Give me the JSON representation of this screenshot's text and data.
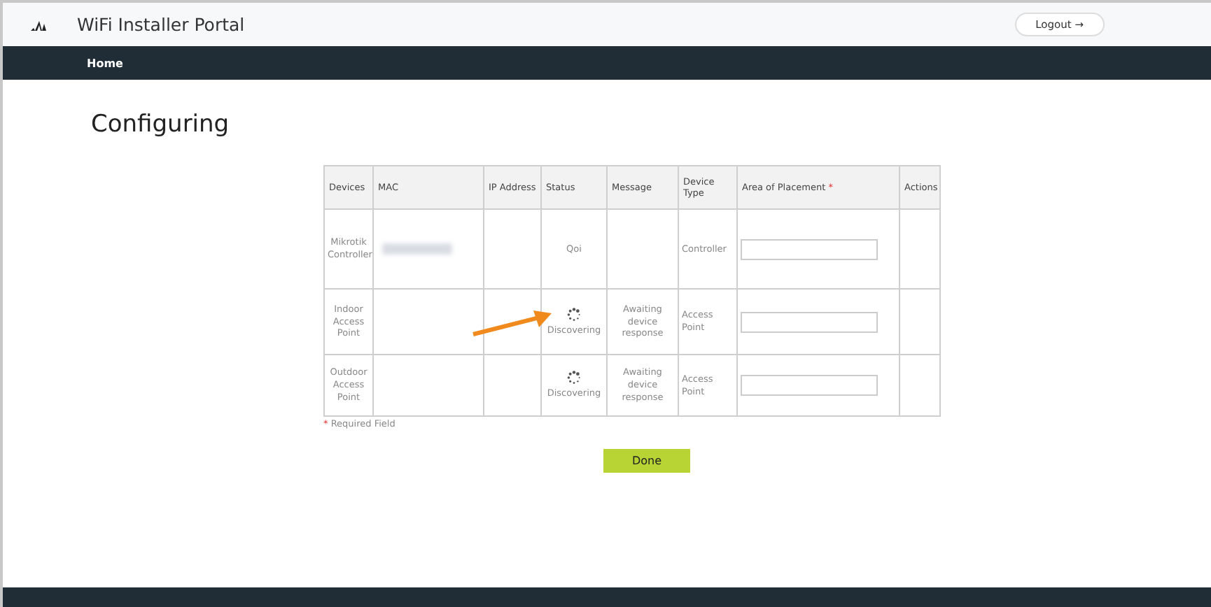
{
  "header": {
    "title": "WiFi Installer Portal",
    "logout": "Logout",
    "logout_arrow": "→"
  },
  "nav": {
    "items": [
      {
        "label": "Home",
        "selected": true
      }
    ]
  },
  "page_title": "Configuring",
  "table": {
    "columns": [
      {
        "label": "Devices",
        "required": false
      },
      {
        "label": "MAC",
        "required": false
      },
      {
        "label": "IP Address",
        "required": false
      },
      {
        "label": "Status",
        "required": false
      },
      {
        "label": "Message",
        "required": false
      },
      {
        "label": "Device Type",
        "required": false
      },
      {
        "label": "Area of Placement",
        "required": true
      },
      {
        "label": "Actions",
        "required": false
      }
    ],
    "rows": [
      {
        "device": "Mikrotik Controller",
        "mac_blurred": true,
        "status": "Qoi",
        "spinner": false,
        "type": "Controller",
        "pointer": false
      },
      {
        "device": "Indoor Access Point",
        "mac_blurred": false,
        "status": "Discovering",
        "spinner": true,
        "message": "Awaiting device response",
        "type": "Access Point",
        "pointer": true
      },
      {
        "device": "Outdoor Access Point",
        "mac_blurred": false,
        "status": "Discovering",
        "spinner": true,
        "message": "Awaiting device response",
        "type": "Access Point",
        "pointer": false
      }
    ]
  },
  "required_note": {
    "mark": "*",
    "text": "Required Field"
  },
  "done_button": "Done"
}
